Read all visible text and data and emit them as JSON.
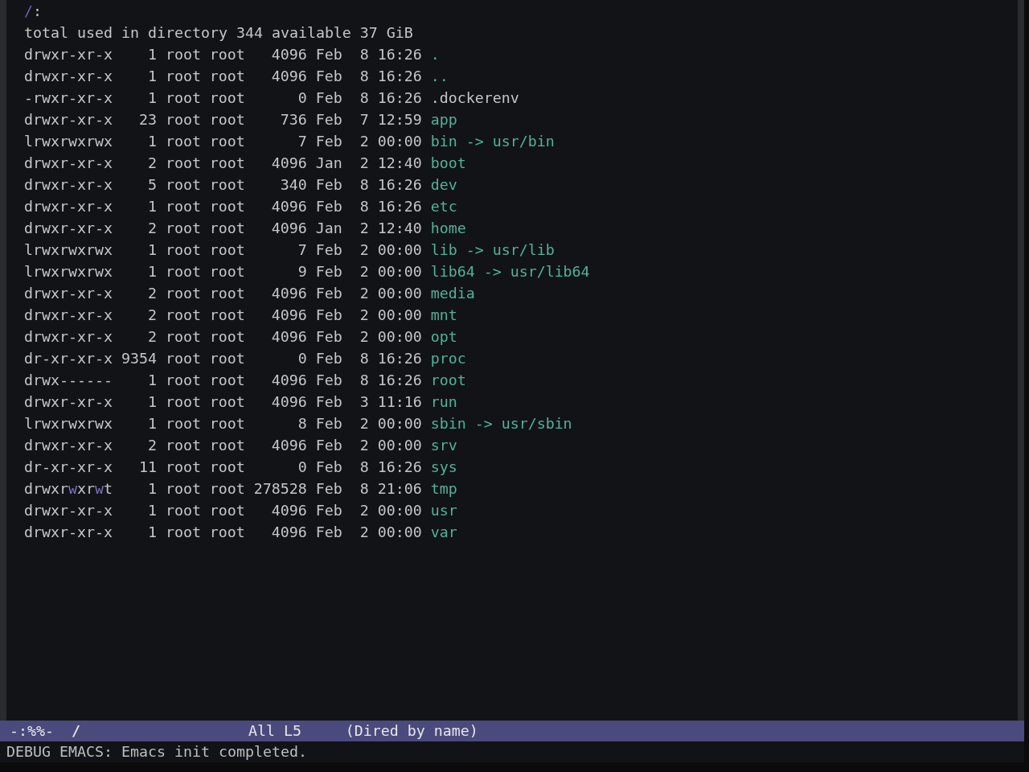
{
  "buffer": {
    "header": {
      "directory": "/",
      "suffix": ":"
    },
    "summary": "total used in directory 344 available 37 GiB",
    "entries": [
      {
        "mode": [
          {
            "text": "drwxr-xr-x",
            "highlight": false
          }
        ],
        "links": "1",
        "owner": "root",
        "group": "root",
        "size": "4096",
        "month": "Feb",
        "day": "8",
        "time": "16:26",
        "name": ".",
        "kind": "directory"
      },
      {
        "mode": [
          {
            "text": "drwxr-xr-x",
            "highlight": false
          }
        ],
        "links": "1",
        "owner": "root",
        "group": "root",
        "size": "4096",
        "month": "Feb",
        "day": "8",
        "time": "16:26",
        "name": "..",
        "kind": "directory"
      },
      {
        "mode": [
          {
            "text": "-rwxr-xr-x",
            "highlight": false
          }
        ],
        "links": "1",
        "owner": "root",
        "group": "root",
        "size": "0",
        "month": "Feb",
        "day": "8",
        "time": "16:26",
        "name": ".dockerenv",
        "kind": "file"
      },
      {
        "mode": [
          {
            "text": "drwxr-xr-x",
            "highlight": false
          }
        ],
        "links": "23",
        "owner": "root",
        "group": "root",
        "size": "736",
        "month": "Feb",
        "day": "7",
        "time": "12:59",
        "name": "app",
        "kind": "directory"
      },
      {
        "mode": [
          {
            "text": "lrwxrwxrwx",
            "highlight": false
          }
        ],
        "links": "1",
        "owner": "root",
        "group": "root",
        "size": "7",
        "month": "Feb",
        "day": "2",
        "time": "00:00",
        "name": "bin -> usr/bin",
        "kind": "symlink"
      },
      {
        "mode": [
          {
            "text": "drwxr-xr-x",
            "highlight": false
          }
        ],
        "links": "2",
        "owner": "root",
        "group": "root",
        "size": "4096",
        "month": "Jan",
        "day": "2",
        "time": "12:40",
        "name": "boot",
        "kind": "directory"
      },
      {
        "mode": [
          {
            "text": "drwxr-xr-x",
            "highlight": false
          }
        ],
        "links": "5",
        "owner": "root",
        "group": "root",
        "size": "340",
        "month": "Feb",
        "day": "8",
        "time": "16:26",
        "name": "dev",
        "kind": "directory"
      },
      {
        "mode": [
          {
            "text": "drwxr-xr-x",
            "highlight": false
          }
        ],
        "links": "1",
        "owner": "root",
        "group": "root",
        "size": "4096",
        "month": "Feb",
        "day": "8",
        "time": "16:26",
        "name": "etc",
        "kind": "directory"
      },
      {
        "mode": [
          {
            "text": "drwxr-xr-x",
            "highlight": false
          }
        ],
        "links": "2",
        "owner": "root",
        "group": "root",
        "size": "4096",
        "month": "Jan",
        "day": "2",
        "time": "12:40",
        "name": "home",
        "kind": "directory"
      },
      {
        "mode": [
          {
            "text": "lrwxrwxrwx",
            "highlight": false
          }
        ],
        "links": "1",
        "owner": "root",
        "group": "root",
        "size": "7",
        "month": "Feb",
        "day": "2",
        "time": "00:00",
        "name": "lib -> usr/lib",
        "kind": "symlink"
      },
      {
        "mode": [
          {
            "text": "lrwxrwxrwx",
            "highlight": false
          }
        ],
        "links": "1",
        "owner": "root",
        "group": "root",
        "size": "9",
        "month": "Feb",
        "day": "2",
        "time": "00:00",
        "name": "lib64 -> usr/lib64",
        "kind": "symlink"
      },
      {
        "mode": [
          {
            "text": "drwxr-xr-x",
            "highlight": false
          }
        ],
        "links": "2",
        "owner": "root",
        "group": "root",
        "size": "4096",
        "month": "Feb",
        "day": "2",
        "time": "00:00",
        "name": "media",
        "kind": "directory"
      },
      {
        "mode": [
          {
            "text": "drwxr-xr-x",
            "highlight": false
          }
        ],
        "links": "2",
        "owner": "root",
        "group": "root",
        "size": "4096",
        "month": "Feb",
        "day": "2",
        "time": "00:00",
        "name": "mnt",
        "kind": "directory"
      },
      {
        "mode": [
          {
            "text": "drwxr-xr-x",
            "highlight": false
          }
        ],
        "links": "2",
        "owner": "root",
        "group": "root",
        "size": "4096",
        "month": "Feb",
        "day": "2",
        "time": "00:00",
        "name": "opt",
        "kind": "directory"
      },
      {
        "mode": [
          {
            "text": "dr-xr-xr-x",
            "highlight": false
          }
        ],
        "links": "9354",
        "owner": "root",
        "group": "root",
        "size": "0",
        "month": "Feb",
        "day": "8",
        "time": "16:26",
        "name": "proc",
        "kind": "directory"
      },
      {
        "mode": [
          {
            "text": "drwx------",
            "highlight": false
          }
        ],
        "links": "1",
        "owner": "root",
        "group": "root",
        "size": "4096",
        "month": "Feb",
        "day": "8",
        "time": "16:26",
        "name": "root",
        "kind": "directory"
      },
      {
        "mode": [
          {
            "text": "drwxr-xr-x",
            "highlight": false
          }
        ],
        "links": "1",
        "owner": "root",
        "group": "root",
        "size": "4096",
        "month": "Feb",
        "day": "3",
        "time": "11:16",
        "name": "run",
        "kind": "directory"
      },
      {
        "mode": [
          {
            "text": "lrwxrwxrwx",
            "highlight": false
          }
        ],
        "links": "1",
        "owner": "root",
        "group": "root",
        "size": "8",
        "month": "Feb",
        "day": "2",
        "time": "00:00",
        "name": "sbin -> usr/sbin",
        "kind": "symlink"
      },
      {
        "mode": [
          {
            "text": "drwxr-xr-x",
            "highlight": false
          }
        ],
        "links": "2",
        "owner": "root",
        "group": "root",
        "size": "4096",
        "month": "Feb",
        "day": "2",
        "time": "00:00",
        "name": "srv",
        "kind": "directory"
      },
      {
        "mode": [
          {
            "text": "dr-xr-xr-x",
            "highlight": false
          }
        ],
        "links": "11",
        "owner": "root",
        "group": "root",
        "size": "0",
        "month": "Feb",
        "day": "8",
        "time": "16:26",
        "name": "sys",
        "kind": "directory"
      },
      {
        "mode": [
          {
            "text": "drwxr",
            "highlight": false
          },
          {
            "text": "w",
            "highlight": true
          },
          {
            "text": "xr",
            "highlight": false
          },
          {
            "text": "w",
            "highlight": true
          },
          {
            "text": "t",
            "highlight": false
          }
        ],
        "links": "1",
        "owner": "root",
        "group": "root",
        "size": "278528",
        "month": "Feb",
        "day": "8",
        "time": "21:06",
        "name": "tmp",
        "kind": "directory"
      },
      {
        "mode": [
          {
            "text": "drwxr-xr-x",
            "highlight": false
          }
        ],
        "links": "1",
        "owner": "root",
        "group": "root",
        "size": "4096",
        "month": "Feb",
        "day": "2",
        "time": "00:00",
        "name": "usr",
        "kind": "directory"
      },
      {
        "mode": [
          {
            "text": "drwxr-xr-x",
            "highlight": false
          }
        ],
        "links": "1",
        "owner": "root",
        "group": "root",
        "size": "4096",
        "month": "Feb",
        "day": "2",
        "time": "00:00",
        "name": "var",
        "kind": "directory"
      }
    ]
  },
  "mode_line": {
    "status": "-:%%-",
    "buffer_name": "/",
    "scroll": "All",
    "line": "L5",
    "major_mode": "(Dired by name)"
  },
  "echo_area": "DEBUG EMACS: Emacs init completed."
}
